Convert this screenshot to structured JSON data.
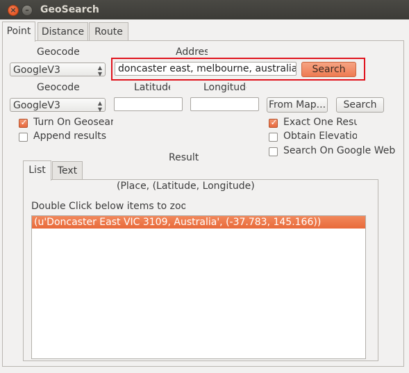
{
  "window": {
    "title": "GeoSearch"
  },
  "tabs": [
    {
      "label": "Point"
    },
    {
      "label": "Distance"
    },
    {
      "label": "Route"
    }
  ],
  "point": {
    "geocoder1_label": "Geocoder",
    "address_label": "Address",
    "geocoder1_value": "GoogleV3",
    "address_value": "doncaster east, melbourne, australia",
    "search_label": "Search",
    "geocoder2_label": "Geocoder",
    "latitude_label": "Latitude",
    "longitude_label": "Longitude",
    "geocoder2_value": "GoogleV3",
    "latitude_value": "",
    "longitude_value": "",
    "from_map_label": "From Map...",
    "search2_label": "Search",
    "options": {
      "turn_on_geosearch": "Turn On Geosearch",
      "append_results": "Append results",
      "exact_one_result": "Exact One Result",
      "obtain_elevation": "Obtain Elevation",
      "search_on_google_web_map": "Search On Google Web Map"
    },
    "result_label": "Result",
    "result_tabs": [
      {
        "label": "List"
      },
      {
        "label": "Text"
      }
    ],
    "result_header": "(Place, (Latitude, Longitude))",
    "zoom_hint": "Double Click below items to zoom",
    "result_items": [
      "(u'Doncaster East VIC 3109, Australia', (-37.783, 145.166))"
    ]
  },
  "colors": {
    "accent": "#e8693e",
    "highlight_frame": "#e0121c",
    "titlebar": "#3c3b37"
  }
}
